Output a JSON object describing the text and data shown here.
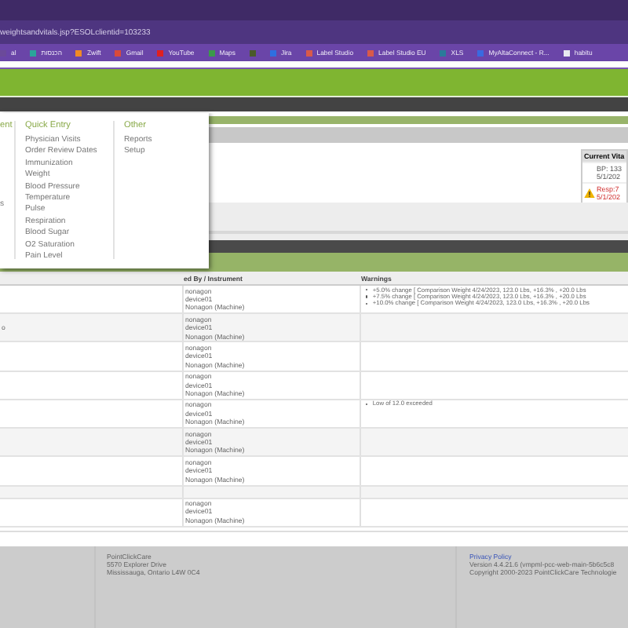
{
  "browser": {
    "address": "weightsandvitals.jsp?ESOLclientid=103233",
    "bookmarks": [
      {
        "label": "al",
        "color": "#6b4a9a"
      },
      {
        "label": "הכנסות",
        "color": "#2aa59a"
      },
      {
        "label": "Zwift",
        "color": "#f08a24"
      },
      {
        "label": "Gmail",
        "color": "#d84a3a"
      },
      {
        "label": "YouTube",
        "color": "#e02020"
      },
      {
        "label": "Maps",
        "color": "#3b9a4a"
      },
      {
        "color": "#4a5a2a"
      },
      {
        "label": "Jira",
        "color": "#2f6fe0"
      },
      {
        "label": "Label Studio",
        "color": "#d85a4a"
      },
      {
        "label": "Label Studio EU",
        "color": "#d85a4a"
      },
      {
        "label": "XLS",
        "color": "#2a7a9a"
      },
      {
        "label": "MyAltaConnect - R...",
        "color": "#3a6ae0"
      },
      {
        "label": "habitu",
        "color": "#e8e8f0"
      }
    ]
  },
  "menu": {
    "columns": [
      {
        "heading": "ent",
        "items": [
          "s"
        ]
      },
      {
        "heading": "Quick Entry",
        "items": [
          "Physician Visits",
          "Order Review Dates",
          "Immunization",
          "Weight",
          "Blood Pressure",
          "Temperature",
          "Pulse",
          "Respiration",
          "Blood Sugar",
          "O2 Saturation",
          "Pain Level"
        ]
      },
      {
        "heading": "Other",
        "items": [
          "Reports",
          "Setup"
        ]
      }
    ]
  },
  "current_vitals": {
    "title": "Current Vita",
    "entries": [
      {
        "reading": "BP: 133",
        "date": "5/1/202",
        "warning": false
      },
      {
        "reading": "Resp:7",
        "date": "5/1/202",
        "warning": true
      }
    ]
  },
  "table": {
    "columns": [
      "ed By / Instrument",
      "Warnings"
    ],
    "rows": [
      {
        "recorded_by": [
          "nonagon",
          "device01",
          "Nonagon (Machine)"
        ],
        "warnings": [
          "+5.0% change [ Comparison Weight 4/24/2023, 123.0 Lbs, +16.3% , +20.0 Lbs",
          "+7.5% change [ Comparison Weight 4/24/2023, 123.0 Lbs, +16.3% , +20.0 Lbs",
          "+10.0% change [ Comparison Weight 4/24/2023, 123.0 Lbs, +16.3% , +20.0 Lbs"
        ]
      },
      {
        "column_1": "o",
        "recorded_by": [
          "nonagon",
          "device01",
          "Nonagon (Machine)"
        ],
        "warnings": []
      },
      {
        "recorded_by": [
          "nonagon",
          "device01",
          "Nonagon (Machine)"
        ],
        "warnings": []
      },
      {
        "recorded_by": [
          "nonagon",
          "device01",
          "Nonagon (Machine)"
        ],
        "warnings": []
      },
      {
        "recorded_by": [
          "nonagon",
          "device01",
          "Nonagon (Machine)"
        ],
        "warnings": [
          "Low of 12.0 exceeded"
        ]
      },
      {
        "recorded_by": [
          "nonagon",
          "device01",
          "Nonagon (Machine)"
        ],
        "warnings": []
      },
      {
        "recorded_by": [
          "nonagon",
          "device01",
          "Nonagon (Machine)"
        ],
        "warnings": []
      },
      {
        "recorded_by": [],
        "warnings": []
      },
      {
        "recorded_by": [
          "nonagon",
          "device01",
          "Nonagon (Machine)"
        ],
        "warnings": []
      }
    ]
  },
  "footer": {
    "address": [
      "PointClickCare",
      "5570 Explorer Drive",
      "Mississauga, Ontario L4W 0C4"
    ],
    "privacy_link": "Privacy Policy",
    "version": "Version 4.4.21.6 (vmpml-pcc-web-main-5b6c5c8",
    "copyright": "Copyright 2000-2023 PointClickCare Technologie"
  }
}
